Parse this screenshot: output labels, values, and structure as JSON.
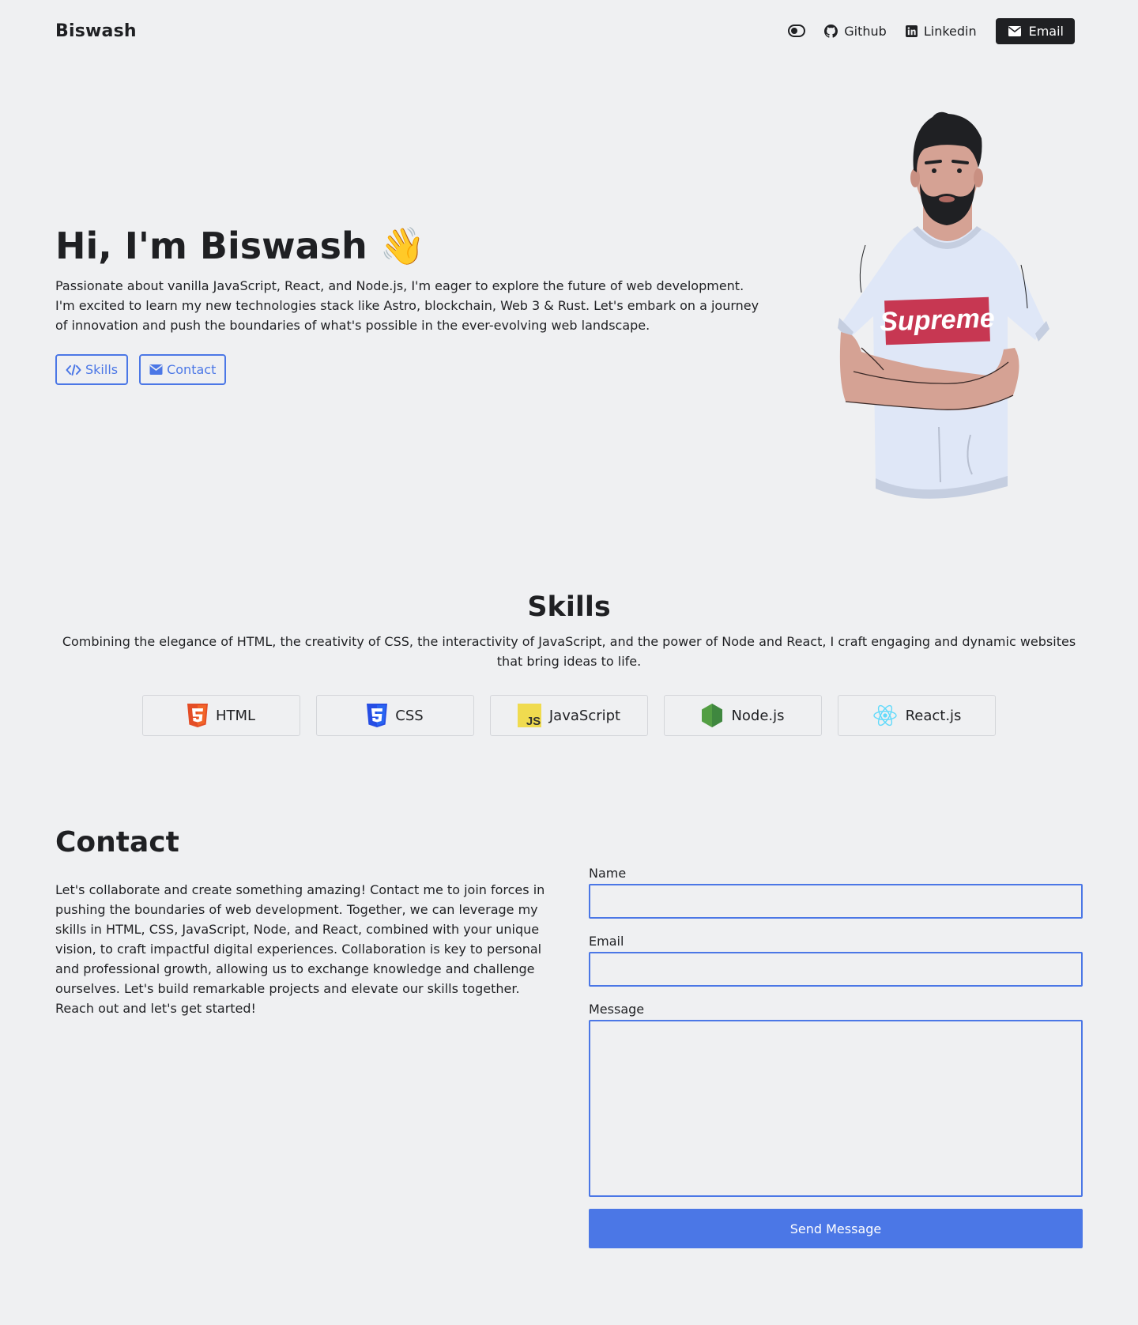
{
  "nav": {
    "brand": "Biswash",
    "toggle_icon": "toggle-icon",
    "github_label": "Github",
    "linkedin_label": "Linkedin",
    "email_label": "Email"
  },
  "hero": {
    "title": "Hi, I'm Biswash 👋",
    "description": "Passionate about vanilla JavaScript, React, and Node.js, I'm eager to explore the future of web development. I'm excited to learn my new technologies stack like Astro, blockchain, Web 3 & Rust. Let's embark on a journey of innovation and push the boundaries of what's possible in the ever-evolving web landscape.",
    "skills_button": "Skills",
    "contact_button": "Contact",
    "avatar_shirt_text": "Supreme"
  },
  "skills": {
    "title": "Skills",
    "description": "Combining the elegance of HTML, the creativity of CSS, the interactivity of JavaScript, and the power of Node and React, I craft engaging and dynamic websites that bring ideas to life.",
    "items": [
      {
        "label": "HTML",
        "icon": "html5-icon"
      },
      {
        "label": "CSS",
        "icon": "css3-icon"
      },
      {
        "label": "JavaScript",
        "icon": "javascript-icon"
      },
      {
        "label": "Node.js",
        "icon": "nodejs-icon"
      },
      {
        "label": "React.js",
        "icon": "react-icon"
      }
    ]
  },
  "contact": {
    "title": "Contact",
    "description": "Let's collaborate and create something amazing! Contact me to join forces in pushing the boundaries of web development. Together, we can leverage my skills in HTML, CSS, JavaScript, Node, and React, combined with your unique vision, to craft impactful digital experiences. Collaboration is key to personal and professional growth, allowing us to exchange knowledge and challenge ourselves. Let's build remarkable projects and elevate our skills together. Reach out and let's get started!",
    "name_label": "Name",
    "name_value": "",
    "email_label": "Email",
    "email_value": "",
    "message_label": "Message",
    "message_value": "",
    "send_button": "Send Message"
  },
  "colors": {
    "background": "#eff0f2",
    "text": "#1f2023",
    "accent": "#4b77e6",
    "dark_button": "#1f2023"
  }
}
